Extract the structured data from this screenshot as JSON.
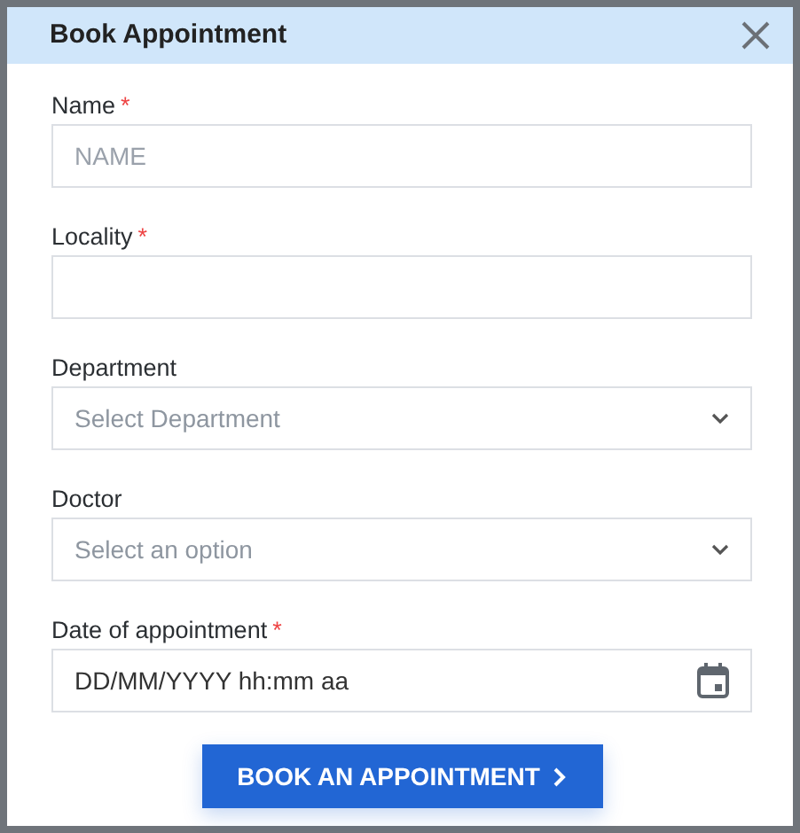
{
  "dialog": {
    "title": "Book Appointment"
  },
  "fields": [
    {
      "kind": "text",
      "label": "Name",
      "required_mark": "*",
      "placeholder": "NAME"
    },
    {
      "kind": "text",
      "label": "Locality",
      "required_mark": "*"
    },
    {
      "kind": "select",
      "label": "Department",
      "placeholder": "Select Department"
    },
    {
      "kind": "select",
      "label": "Doctor",
      "placeholder": "Select an option"
    },
    {
      "kind": "date",
      "label": "Date of appointment",
      "required_mark": "*",
      "value": "DD/MM/YYYY hh:mm aa"
    }
  ],
  "submit_button": {
    "label": "BOOK AN APPOINTMENT"
  }
}
